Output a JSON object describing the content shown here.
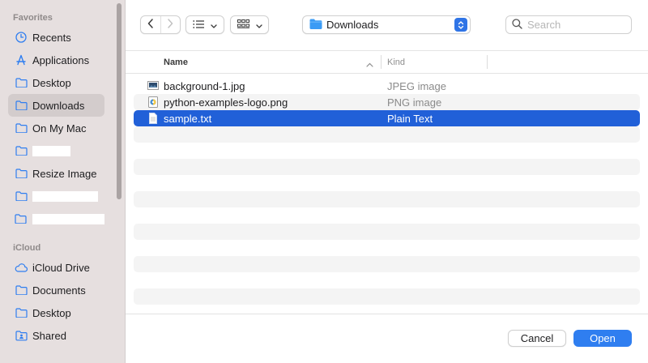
{
  "sidebar": {
    "favorites_title": "Favorites",
    "icloud_title": "iCloud",
    "favorites": [
      {
        "label": "Recents",
        "icon": "clock-icon"
      },
      {
        "label": "Applications",
        "icon": "applications-icon"
      },
      {
        "label": "Desktop",
        "icon": "folder-icon"
      },
      {
        "label": "Downloads",
        "icon": "folder-icon",
        "selected": true
      },
      {
        "label": "On My Mac",
        "icon": "folder-icon"
      },
      {
        "label": "",
        "icon": "folder-icon",
        "redacted": true
      },
      {
        "label": "Resize Image",
        "icon": "folder-icon"
      },
      {
        "label": "",
        "icon": "folder-icon",
        "redacted": true
      },
      {
        "label": "",
        "icon": "folder-icon",
        "redacted": true
      }
    ],
    "icloud": [
      {
        "label": "iCloud Drive",
        "icon": "cloud-icon"
      },
      {
        "label": "Documents",
        "icon": "folder-icon"
      },
      {
        "label": "Desktop",
        "icon": "folder-icon"
      },
      {
        "label": "Shared",
        "icon": "shared-folder-icon"
      }
    ]
  },
  "toolbar": {
    "back_icon": "chevron-left-icon",
    "forward_icon": "chevron-right-icon",
    "list_view_icon": "list-icon",
    "group_view_icon": "grid-icon",
    "location": "Downloads",
    "search_placeholder": "Search"
  },
  "file_list": {
    "columns": {
      "name": "Name",
      "kind": "Kind"
    },
    "sort": "ascending",
    "rows": [
      {
        "name": "background-1.jpg",
        "kind": "JPEG image",
        "icon": "image-file-icon"
      },
      {
        "name": "python-examples-logo.png",
        "kind": "PNG image",
        "icon": "image-file-icon"
      },
      {
        "name": "sample.txt",
        "kind": "Plain Text",
        "icon": "text-file-icon",
        "selected": true
      }
    ]
  },
  "buttons": {
    "cancel": "Cancel",
    "open": "Open"
  },
  "colors": {
    "accent": "#2f7ef0",
    "selection": "#2160d8",
    "sidebar_bg": "#e6dfdf"
  }
}
